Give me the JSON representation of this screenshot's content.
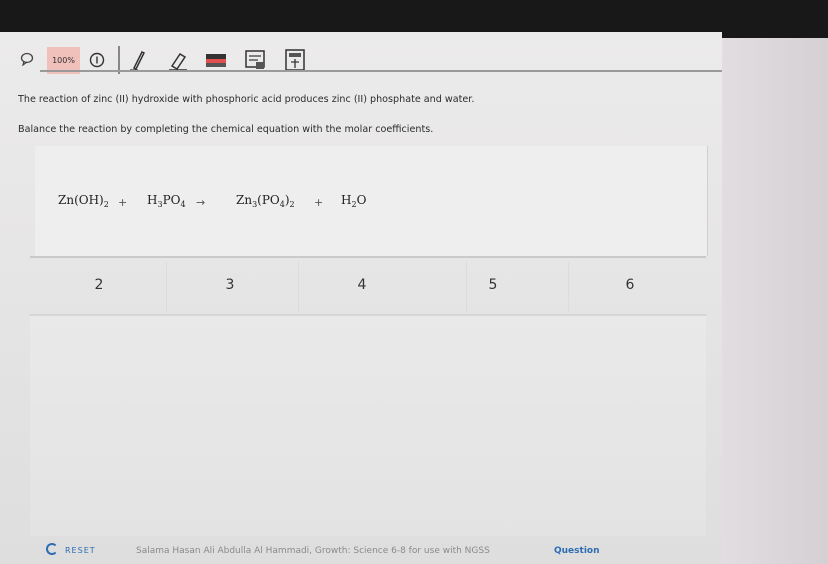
{
  "toolbar": {
    "zoom_label": "100%",
    "tools": [
      "comment-icon",
      "zoom-in-icon",
      "pen-icon",
      "eraser-icon",
      "highlighter-icon",
      "screen-icon",
      "calculator-icon"
    ]
  },
  "question": {
    "line1": "The reaction of zinc (II) hydroxide with phosphoric acid produces zinc (II) phosphate and water.",
    "line2": "Balance the reaction by completing the chemical equation with the molar coefficients."
  },
  "equation": {
    "term1": {
      "base": "Zn(OH)",
      "sub": "2"
    },
    "plus1": "+",
    "term2": {
      "a": "H",
      "a_sub": "3",
      "b": "PO",
      "b_sub": "4"
    },
    "arrow": "→",
    "term3": {
      "a": "Zn",
      "a_sub": "3",
      "b": "(PO",
      "b_sub": "4",
      "c": ")",
      "c_sub": "2"
    },
    "plus2": "+",
    "term4": {
      "a": "H",
      "a_sub": "2",
      "b": "O"
    }
  },
  "coefficients": [
    "2",
    "3",
    "4",
    "5",
    "6"
  ],
  "footer": {
    "reset": "RESET",
    "credit": "Salama Hasan Ali Abdulla Al Hammadi,   Growth: Science 6-8  for use with NGSS",
    "question": "Question"
  },
  "colors": {
    "accent": "#2c6db3",
    "zoom_bg": "#f0c0bb"
  }
}
